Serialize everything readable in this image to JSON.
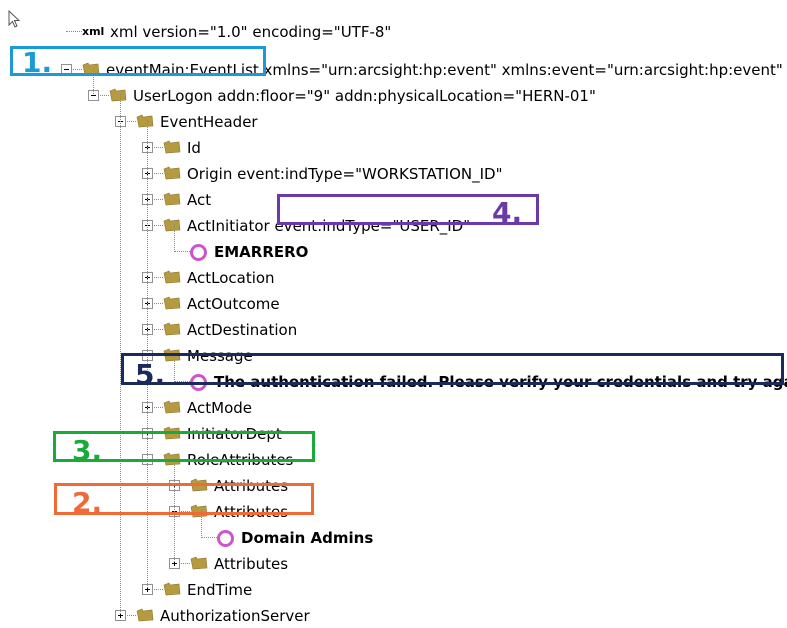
{
  "nodes": [
    {
      "label": "xml version=\"1.0\" encoding=\"UTF-8\"",
      "icon": "xml-declaration-icon",
      "expander": "none"
    },
    {
      "label": "eventMain:EventList xmlns=\"urn:arcsight:hp:event\"  xmlns:event=\"urn:arcsight:hp:event\"",
      "icon": "folder-icon",
      "expander": "minus"
    },
    {
      "label": "UserLogon addn:floor=\"9\"  addn:physicalLocation=\"HERN-01\"",
      "icon": "folder-icon",
      "expander": "minus"
    },
    {
      "label": "EventHeader",
      "icon": "folder-icon",
      "expander": "minus"
    },
    {
      "label": "Id",
      "icon": "folder-icon",
      "expander": "plus"
    },
    {
      "label": "Origin event:indType=\"WORKSTATION_ID\"",
      "icon": "folder-icon",
      "expander": "plus"
    },
    {
      "label": "Act",
      "icon": "folder-icon",
      "expander": "plus"
    },
    {
      "label": "ActInitiator event:indType=\"USER_ID\"",
      "icon": "folder-icon",
      "expander": "minus"
    },
    {
      "label": "EMARRERO",
      "icon": "text-node-icon",
      "expander": "none"
    },
    {
      "label": "ActLocation",
      "icon": "folder-icon",
      "expander": "plus"
    },
    {
      "label": "ActOutcome",
      "icon": "folder-icon",
      "expander": "plus"
    },
    {
      "label": "ActDestination",
      "icon": "folder-icon",
      "expander": "plus"
    },
    {
      "label": "Message",
      "icon": "folder-icon",
      "expander": "minus"
    },
    {
      "label": "The authentication failed. Please verify your credentials and try again.",
      "icon": "text-node-icon",
      "expander": "none"
    },
    {
      "label": "ActMode",
      "icon": "folder-icon",
      "expander": "plus"
    },
    {
      "label": "InitiatorDept",
      "icon": "folder-icon",
      "expander": "plus"
    },
    {
      "label": "RoleAttributes",
      "icon": "folder-icon",
      "expander": "minus"
    },
    {
      "label": "Attributes",
      "icon": "folder-icon",
      "expander": "plus"
    },
    {
      "label": "Attributes",
      "icon": "folder-icon",
      "expander": "minus"
    },
    {
      "label": "Domain Admins",
      "icon": "text-node-icon",
      "expander": "none"
    },
    {
      "label": "Attributes",
      "icon": "folder-icon",
      "expander": "plus"
    },
    {
      "label": "EndTime",
      "icon": "folder-icon",
      "expander": "plus"
    },
    {
      "label": "AuthorizationServer",
      "icon": "folder-icon",
      "expander": "plus"
    }
  ],
  "xml_icon_text": "xml",
  "annotations": [
    {
      "number": "1.",
      "color": "#1a9bd7"
    },
    {
      "number": "2.",
      "color": "#f06a35"
    },
    {
      "number": "3.",
      "color": "#1aaa3a"
    },
    {
      "number": "4.",
      "color": "#6a3aa8"
    },
    {
      "number": "5.",
      "color": "#1a2a5a"
    }
  ],
  "colors": {
    "folder": "#b59a3f",
    "text_node_ring": "#cc55cc",
    "tree_lines": "#8a8a8a"
  }
}
